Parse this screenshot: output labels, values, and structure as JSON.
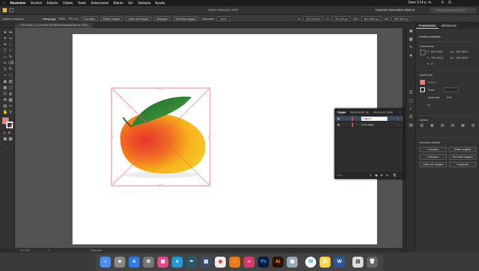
{
  "menubar": {
    "apple": "",
    "items": [
      "Illustrator",
      "Archivo",
      "Edición",
      "Objeto",
      "Texto",
      "Seleccionar",
      "Efecto",
      "Ver",
      "Ventana",
      "Ayuda"
    ],
    "clock": "Dom 3:14 p. m."
  },
  "titlebar": {
    "title": "Adobe Illustrator 2020",
    "workspace": "Aspectos esenciales clásicos",
    "search_placeholder": "Buscar en Adobe Stock"
  },
  "controlbar": {
    "selection": "Archivo enlazado",
    "filename": "Mango.jpg",
    "colormode": "RGB",
    "ppi": "PPI: 117",
    "buttons": [
      "Incrustar",
      "Editar original",
      "Calco de imagen",
      "Máscara",
      "Recortar imagen"
    ],
    "opacity_label": "Opacidad:",
    "opacity_value": "100%",
    "x": "637,6162 pt",
    "y": "751,333 pt",
    "w": "687,8433 pt",
    "h": "687,8433 pt"
  },
  "doctab": {
    "label": "Sin título-1* al 19,15% (RGB/Previsualización de GPU)"
  },
  "statusbar": {
    "zoom": "19,15%",
    "page": "1",
    "tool": "Selección"
  },
  "properties": {
    "tabs": [
      "Propiedades",
      "Bibliotecas"
    ],
    "section_type": "Archivo enlazado",
    "transform_title": "Transformar",
    "x": "637,6162",
    "y": "751,333 p",
    "w": "687,8433",
    "h": "687,8433",
    "angle": "0°",
    "appearance_title": "Apariencia",
    "fill_label": "Relleno",
    "stroke_label": "Trazo",
    "opacity_label": "Opacidad",
    "opacity_value": "100%",
    "align_title": "Alinear",
    "quick_actions_title": "Acciones rápidas",
    "quick_actions": [
      "Incrustar",
      "Editar original",
      "Máscara",
      "Recortar imagen",
      "Calco de imagen",
      "Organizar"
    ]
  },
  "layers": {
    "tabs": [
      "Capas",
      "Exportación de",
      "Mesas de traba"
    ],
    "rows": [
      {
        "name": "Capa 2",
        "selected": true,
        "color": "#e24a4a"
      },
      {
        "name": "Foto Base",
        "selected": false,
        "color": "#e24a4a"
      }
    ],
    "footer": "2 C..."
  },
  "dock": {
    "apps": [
      "finder",
      "launchpad",
      "app-store",
      "system-preferences",
      "screenshots",
      "edge",
      "illustrator-store",
      "chrome",
      "blender",
      "creative-cloud",
      "photoshop",
      "illustrator",
      "preview",
      "webex",
      "notes",
      "word",
      "finder-2",
      "trash"
    ]
  },
  "colors": {
    "fill": "#f08080",
    "selection": "#e06060",
    "ui_dark": "#323232"
  }
}
